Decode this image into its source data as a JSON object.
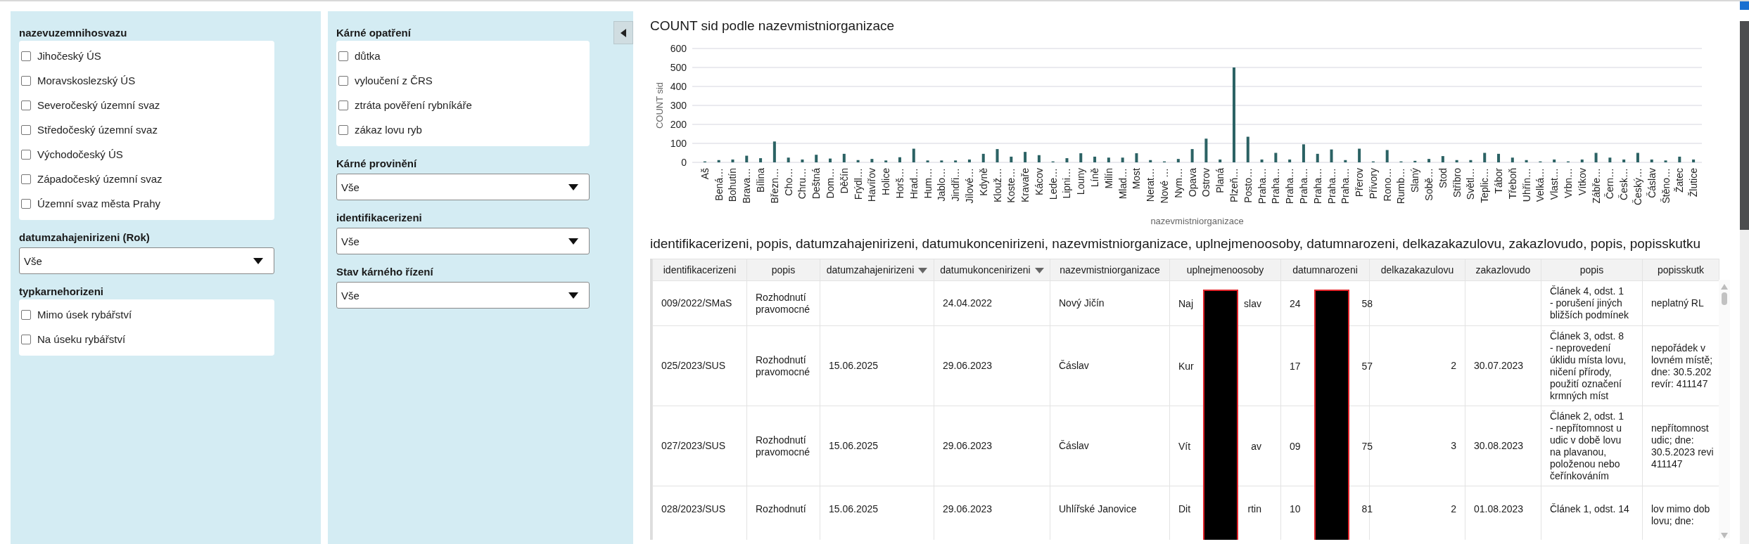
{
  "filters_left": [
    {
      "kind": "checklist",
      "title": "nazevuzemnihosvazu",
      "items": [
        {
          "label": "Jihočeský ÚS",
          "checked": false
        },
        {
          "label": "Moravskoslezský ÚS",
          "checked": false
        },
        {
          "label": "Severočeský územní svaz",
          "checked": false
        },
        {
          "label": "Středočeský územní svaz",
          "checked": false
        },
        {
          "label": "Východočeský ÚS",
          "checked": false
        },
        {
          "label": "Západočeský územní svaz",
          "checked": false
        },
        {
          "label": "Územní svaz města Prahy",
          "checked": false
        }
      ]
    },
    {
      "kind": "dropdown",
      "title": "datumzahajenirizeni (Rok)",
      "value": "Vše"
    },
    {
      "kind": "checklist",
      "title": "typkarnehorizeni",
      "items": [
        {
          "label": "Mimo úsek rybářství",
          "checked": false
        },
        {
          "label": "Na úseku rybářství",
          "checked": false
        }
      ]
    }
  ],
  "filters_right": [
    {
      "kind": "checklist",
      "title": "Kárné opatření",
      "items": [
        {
          "label": "důtka",
          "checked": false
        },
        {
          "label": "vyloučení z ČRS",
          "checked": false
        },
        {
          "label": "ztráta pověření rybníkáře",
          "checked": false
        },
        {
          "label": "zákaz lovu ryb",
          "checked": false
        }
      ]
    },
    {
      "kind": "dropdown",
      "title": "Kárné provinění",
      "value": "Vše"
    },
    {
      "kind": "dropdown",
      "title": "identifikacerizeni",
      "value": "Vše"
    },
    {
      "kind": "dropdown",
      "title": "Stav kárného řízení",
      "value": "Vše"
    }
  ],
  "chart": {
    "title": "COUNT sid podle nazevmistniorganizace",
    "chart_data": {
      "type": "bar",
      "xlabel": "nazevmistniorganizace",
      "ylabel": "COUNT sid",
      "yticks": [
        0,
        100,
        200,
        300,
        400,
        500,
        600
      ],
      "ylim": [
        0,
        600
      ],
      "categories": [
        "Aš",
        "Bená…",
        "Bohutín",
        "Brava…",
        "Bílina",
        "Březn…",
        "Cho…",
        "Chru…",
        "Deštná",
        "Dom…",
        "Děčín",
        "Frýdl…",
        "Havířov",
        "Holice",
        "Horš…",
        "Hrad…",
        "Hum…",
        "Jablo…",
        "Jindři…",
        "Jílové…",
        "Kdyně",
        "Klouž…",
        "Koste…",
        "Kravaře",
        "Kácov",
        "Lede…",
        "Lipni…",
        "Louny",
        "Líně",
        "Milín",
        "Mlad…",
        "Most",
        "Nerat…",
        "Nové …",
        "Nym…",
        "Opava",
        "Ostrov",
        "Planá",
        "Plzeň…",
        "Posto…",
        "Praha…",
        "Praha…",
        "Praha…",
        "Praha…",
        "Praha…",
        "Praha…",
        "Praha…",
        "Přerov",
        "Přívory",
        "Rono…",
        "Rumb…",
        "Slaný",
        "Sobě…",
        "Stod",
        "Stříbro",
        "Světl…",
        "Teplic…",
        "Tábor",
        "Třeboň",
        "Uhřín…",
        "Velká…",
        "Vlast…",
        "Vrbn…",
        "Vítkov",
        "Zábře…",
        "Čern…",
        "Česk…",
        "Český…",
        "Čáslav",
        "Štěno…",
        "Žatec",
        "Žlutice"
      ],
      "grid": true,
      "values": [
        5,
        12,
        15,
        35,
        22,
        110,
        25,
        15,
        40,
        20,
        45,
        12,
        18,
        10,
        27,
        72,
        10,
        10,
        10,
        15,
        45,
        70,
        30,
        55,
        38,
        5,
        22,
        48,
        30,
        25,
        25,
        48,
        12,
        5,
        18,
        70,
        125,
        15,
        500,
        135,
        15,
        50,
        15,
        95,
        45,
        68,
        12,
        72,
        5,
        65,
        5,
        8,
        18,
        33,
        12,
        12,
        50,
        45,
        25,
        12,
        5,
        15,
        5,
        15,
        50,
        25,
        15,
        50,
        15,
        10,
        30,
        15
      ]
    }
  },
  "table": {
    "title": "identifikacerizeni, popis, datumzahajenirizeni, datumukoncenirizeni, nazevmistniorganizace, uplnejmenoosoby, datumnarozeni, delkazakazulovu, zakazlovudo, popis, popisskutku",
    "columns": [
      {
        "label": "identifikacerizeni",
        "has_menu": false
      },
      {
        "label": "popis",
        "has_menu": false
      },
      {
        "label": "datumzahajenirizeni",
        "has_menu": true
      },
      {
        "label": "datumukoncenirizeni",
        "has_menu": true
      },
      {
        "label": "nazevmistniorganizace",
        "has_menu": false
      },
      {
        "label": "uplnejmenoosoby",
        "has_menu": false
      },
      {
        "label": "datumnarozeni",
        "has_menu": false
      },
      {
        "label": "delkazakazulovu",
        "has_menu": false
      },
      {
        "label": "zakazlovudo",
        "has_menu": false
      },
      {
        "label": "popis",
        "has_menu": false
      },
      {
        "label": "popisskutk",
        "has_menu": false
      }
    ],
    "rows": [
      [
        [
          "009/2022/SMaS"
        ],
        [
          "Rozhodnutí",
          "pravomocné"
        ],
        [],
        [
          "24.04.2022"
        ],
        [
          "Nový Jičín"
        ],
        {
          "before": "Naj",
          "after": "slav"
        },
        {
          "before": "24",
          "after": "58"
        },
        [],
        [],
        [
          "Článek 4, odst. 1",
          "- porušení jiných",
          "bližších podmínek"
        ],
        [
          "neplatný RL"
        ]
      ],
      [
        [
          "025/2023/SUS"
        ],
        [
          "Rozhodnutí",
          "pravomocné"
        ],
        [
          "15.06.2025"
        ],
        [
          "29.06.2023"
        ],
        [
          "Čáslav"
        ],
        {
          "before": "Kur"
        },
        {
          "before": "17",
          "after": "57"
        },
        [
          {
            "kind": "number",
            "text": "2"
          }
        ],
        [
          "30.07.2023"
        ],
        [
          "Článek 3, odst. 8",
          "- neprovedení",
          "úklidu místa lovu,",
          "ničení přírody,",
          "použití označení",
          "krmných míst"
        ],
        [
          "nepořádek v",
          "lovném místě;",
          "dne: 30.5.202",
          "revír: 411147"
        ]
      ],
      [
        [
          "027/2023/SUS"
        ],
        [
          "Rozhodnutí",
          "pravomocné"
        ],
        [
          "15.06.2025"
        ],
        [
          "29.06.2023"
        ],
        [
          "Čáslav"
        ],
        {
          "before": "Vít",
          "after": "av"
        },
        {
          "before": "09",
          "after": "75"
        },
        [
          {
            "kind": "number",
            "text": "3"
          }
        ],
        [
          "30.08.2023"
        ],
        [
          "Článek 2, odst. 1",
          "- nepřítomnost u",
          "udic v době lovu",
          "na plavanou,",
          "položenou nebo",
          "čeřínkováním"
        ],
        [
          "nepřítomnost",
          "udic; dne:",
          "30.5.2023 revi",
          "411147"
        ]
      ],
      [
        [
          "028/2023/SUS"
        ],
        [
          "Rozhodnutí"
        ],
        [
          "15.06.2025"
        ],
        [
          "29.06.2023"
        ],
        [
          "Uhlířské Janovice"
        ],
        {
          "before": "Dit",
          "after": "rtin"
        },
        {
          "before": "10",
          "after": "81"
        },
        [
          {
            "kind": "number",
            "text": "2"
          }
        ],
        [
          "01.08.2023"
        ],
        [
          "Článek 1, odst. 14"
        ],
        [
          "lov mimo dob",
          "lovu; dne:"
        ]
      ]
    ]
  }
}
